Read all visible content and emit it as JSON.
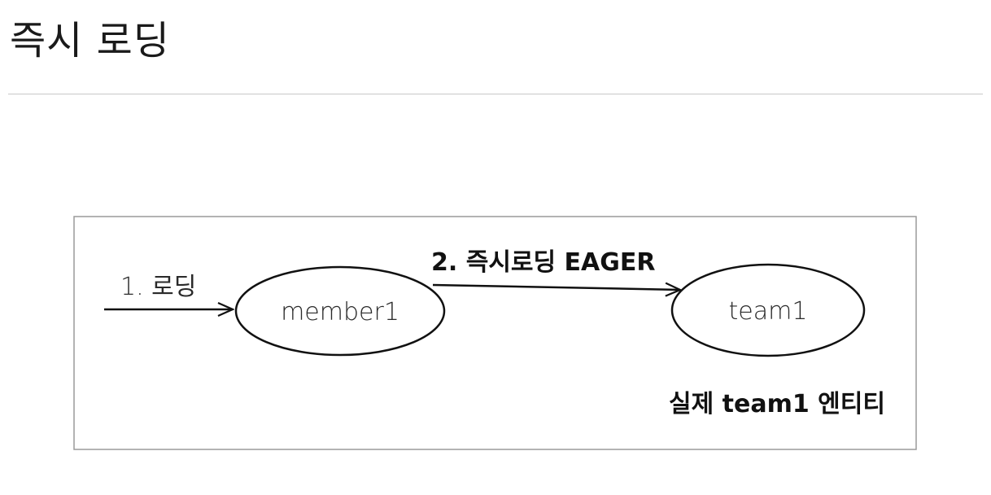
{
  "page": {
    "title": "즉시 로딩"
  },
  "diagram": {
    "nodes": [
      {
        "id": "member1",
        "label": "member1"
      },
      {
        "id": "team1",
        "label": "team1"
      }
    ],
    "edges": [
      {
        "id": "initial-load",
        "from": "",
        "to": "member1",
        "label": "1. 로딩"
      },
      {
        "id": "eager-load",
        "from": "member1",
        "to": "team1",
        "label": "2. 즉시로딩 EAGER"
      }
    ],
    "caption": "실제 team1 엔티티",
    "colors": {
      "stroke": "#111111",
      "frame": "#9a9a9a",
      "fill": "#ffffff"
    }
  }
}
